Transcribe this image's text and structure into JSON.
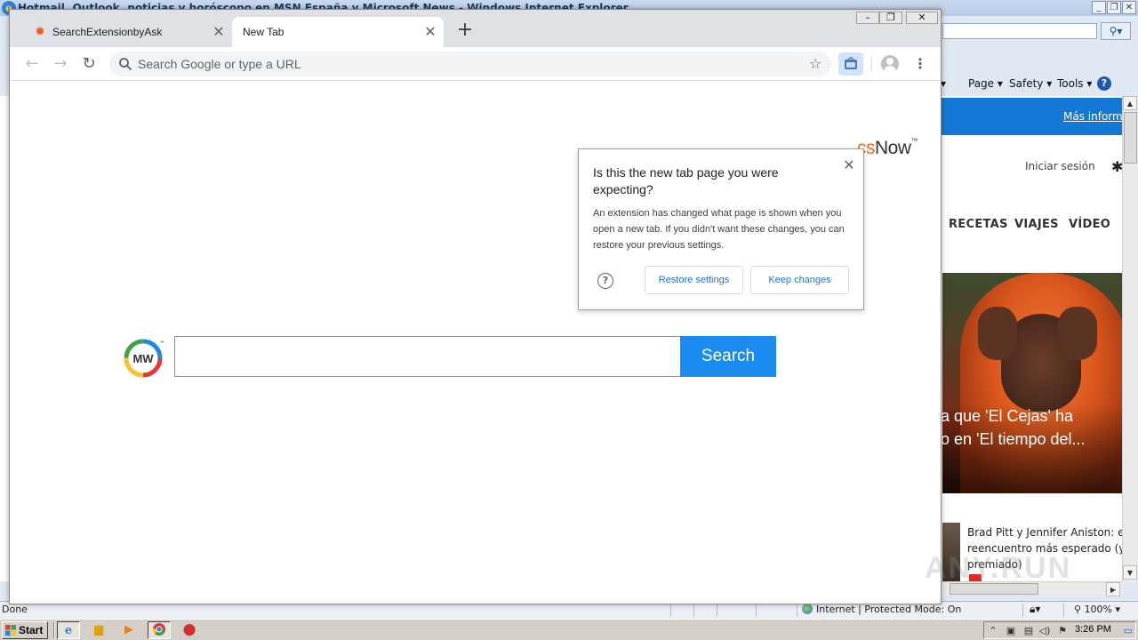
{
  "ie": {
    "title": "Hotmail, Outlook, noticias y horóscopo en MSN España y Microsoft News - Windows Internet Explorer",
    "command_bar": {
      "page": "Page ▾",
      "safety": "Safety ▾",
      "tools": "Tools ▾"
    },
    "msn": {
      "more_info_link": "Más informa",
      "login": "Iniciar sesión",
      "nav": [
        "RECETAS",
        "VIAJES",
        "VÍDEO"
      ],
      "hero_caption_lines": [
        "a que 'El Cejas' ha",
        "o en 'El tiempo del..."
      ],
      "card_lines": [
        "Brad Pitt y Jennifer Aniston: el",
        "reencuentro más esperado (y",
        "premiado)"
      ]
    },
    "status": {
      "left": "Done",
      "zone": "Internet | Protected Mode: On",
      "zoom": "100%"
    }
  },
  "chrome": {
    "tabs": [
      {
        "title": "SearchExtensionbyAsk",
        "active": false
      },
      {
        "title": "New Tab",
        "active": true
      }
    ],
    "omnibox": {
      "placeholder": "Search Google or type a URL",
      "value": ""
    },
    "page": {
      "search_button": "Search",
      "brand_part1": "cs",
      "brand_part2": "Now",
      "logo_text": "MW"
    },
    "popup": {
      "title": "Is this the new tab page you were expecting?",
      "body": "An extension has changed what page is shown when you open a new tab. If you didn't want these changes, you can restore your previous settings.",
      "restore_button": "Restore settings",
      "keep_button": "Keep changes"
    }
  },
  "taskbar": {
    "start_label": "Start",
    "clock": "3:26 PM"
  },
  "watermark": "ANY.RUN"
}
